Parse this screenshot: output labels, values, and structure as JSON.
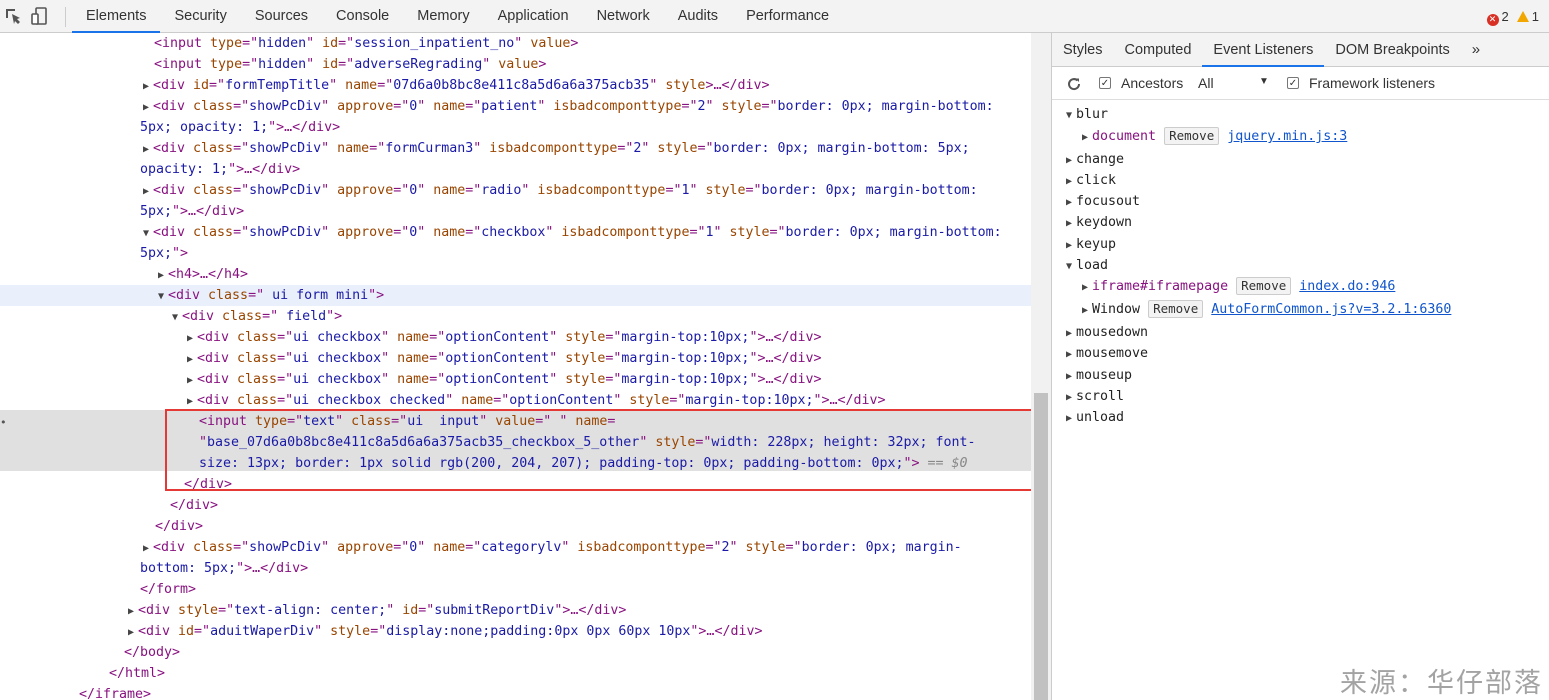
{
  "toolbar": {
    "tabs": [
      "Elements",
      "Security",
      "Sources",
      "Console",
      "Memory",
      "Application",
      "Network",
      "Audits",
      "Performance"
    ],
    "errors": "2",
    "warnings": "1"
  },
  "dom": {
    "l0": {
      "n": "session_inpatient_no"
    },
    "l1": {
      "n": "adverseRegrading"
    },
    "l2": {
      "id": "formTempTitle",
      "name": "07d6a0b8bc8e411c8a5d6a6a375acb35"
    },
    "l3a": {
      "approve": "0",
      "name": "patient",
      "type": "2",
      "style": "border: 0px; margin-bottom:"
    },
    "l3b": "5px; opacity: 1;",
    "l5a": {
      "name": "formCurman3",
      "type": "2",
      "style": "border: 0px; margin-bottom: 5px;"
    },
    "l5b": "opacity: 1;",
    "l7a": {
      "approve": "0",
      "name": "radio",
      "type": "1",
      "style": "border: 0px; margin-bottom:"
    },
    "l7b": "5px;",
    "l9a": {
      "approve": "0",
      "name": "checkbox",
      "type": "1",
      "style": "border: 0px; margin-bottom:"
    },
    "l9b": "5px;",
    "formmini": " ui form mini",
    "field": " field",
    "cb1": "ui checkbox",
    "cb4": "ui checkbox checked",
    "optname": "optionContent",
    "optstyle": "margin-top:10px;",
    "inp": {
      "type": "text",
      "class": "ui  input",
      "value": " ",
      "name": "base_07d6a0b8bc8e411c8a5d6a6a375acb35_checkbox_5_other",
      "style1": "width: 228px; height: 32px; font-",
      "style2": "size: 13px; border: 1px solid rgb(200, 204, 207); padding-top: 0px; padding-bottom: 0px;",
      "eq": "== $0"
    },
    "cat": {
      "approve": "0",
      "name": "categorylv",
      "type": "2",
      "style": "border: 0px; margin-"
    },
    "catb": "bottom: 5px;",
    "submit": {
      "style": "text-align: center;",
      "id": "submitReportDiv"
    },
    "aduit": {
      "id": "aduitWaperDiv",
      "style": "display:none;padding:0px 0px 60px 10px"
    }
  },
  "panel": {
    "tabs": [
      "Styles",
      "Computed",
      "Event Listeners",
      "DOM Breakpoints"
    ],
    "ancestors": "Ancestors",
    "all": "All",
    "framework": "Framework listeners",
    "remove": "Remove",
    "events": [
      "blur",
      "change",
      "click",
      "focusout",
      "keydown",
      "keyup",
      "load",
      "mousedown",
      "mousemove",
      "mouseup",
      "scroll",
      "unload"
    ],
    "blur_doc": "document",
    "blur_src": "jquery.min.js:3",
    "load_iframe": "iframe#iframepage",
    "load_iframe_src": "index.do:946",
    "load_window": "Window",
    "load_window_src": "AutoFormCommon.js?v=3.2.1:6360"
  },
  "watermark": "来源：华仔部落"
}
